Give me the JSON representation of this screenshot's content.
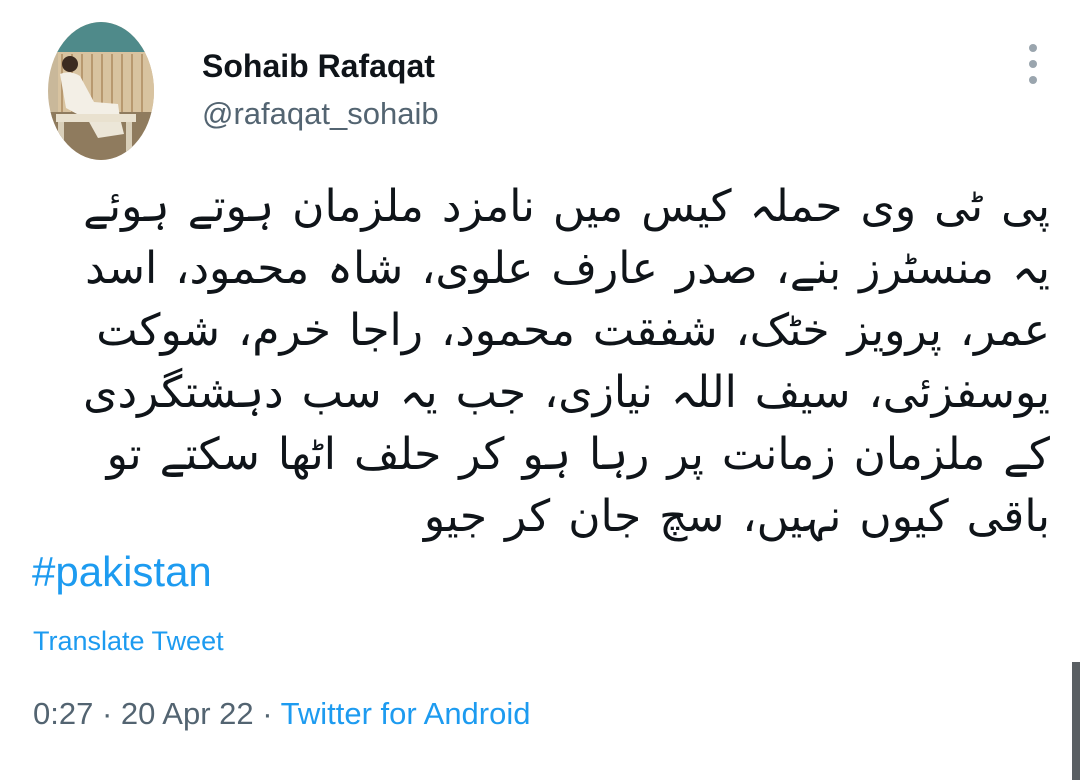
{
  "user": {
    "display_name": "Sohaib Rafaqat",
    "handle": "@rafaqat_sohaib"
  },
  "tweet": {
    "text": "پی ٹی وی حملہ کیس میں نامزد ملزمان ہوتے ہوئے یہ منسٹرز بنے، صدر عارف علوی، شاہ محمود، اسد عمر، پرویز خٹک، شفقت محمود، راجا خرم، شوکت یوسفزئی، سیف اللہ نیازی، جب یہ سب دہشتگردی کے ملزمان زمانت پر رہا ہو کر حلف اٹھا سکتے تو باقی کیوں نہیں، سچ جان کر جیو",
    "hashtag": "#pakistan",
    "translate_label": "Translate Tweet",
    "time": "0:27",
    "separator": "·",
    "date": "20 Apr 22",
    "source": "Twitter for Android"
  },
  "icons": {
    "more": "more-vertical-icon",
    "avatar": "profile-photo"
  },
  "colors": {
    "link": "#1d9bf0",
    "secondary_text": "#536471",
    "primary_text": "#0f1419"
  }
}
